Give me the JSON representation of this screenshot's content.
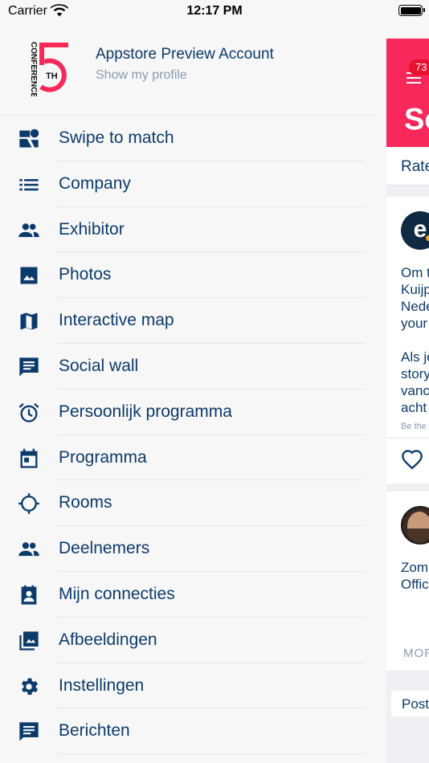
{
  "status_bar": {
    "carrier": "Carrier",
    "time": "12:17 PM"
  },
  "profile": {
    "logo_number": "5",
    "logo_suffix": "TH",
    "logo_text": "CONFERENCE",
    "account_name": "Appstore Preview Account",
    "profile_link": "Show my profile"
  },
  "menu": {
    "items": [
      {
        "label": "Swipe to match",
        "icon": "swipe-match-icon"
      },
      {
        "label": "Company",
        "icon": "list-icon"
      },
      {
        "label": "Exhibitor",
        "icon": "people-icon"
      },
      {
        "label": "Photos",
        "icon": "image-icon"
      },
      {
        "label": "Interactive map",
        "icon": "map-icon"
      },
      {
        "label": "Social wall",
        "icon": "chat-icon"
      },
      {
        "label": "Persoonlijk programma",
        "icon": "alarm-icon"
      },
      {
        "label": "Programma",
        "icon": "calendar-icon"
      },
      {
        "label": "Rooms",
        "icon": "crosshair-icon"
      },
      {
        "label": "Deelnemers",
        "icon": "people-icon"
      },
      {
        "label": "Mijn connecties",
        "icon": "contact-icon"
      },
      {
        "label": "Afbeeldingen",
        "icon": "gallery-icon"
      },
      {
        "label": "Instellingen",
        "icon": "gear-icon"
      },
      {
        "label": "Berichten",
        "icon": "message-icon"
      }
    ]
  },
  "peek": {
    "badge": "73",
    "title": "So",
    "tab": "Rate",
    "card1": {
      "avatar_letter": "e",
      "lines_a": [
        "Om t",
        "Kuijp",
        "Nede",
        "your"
      ],
      "lines_b": [
        "Als je",
        "story",
        "vanc",
        "acht"
      ],
      "small": "Be the"
    },
    "card2": {
      "lines": [
        "Zom",
        "Offic"
      ],
      "more": "MOR"
    },
    "post": "Post"
  },
  "colors": {
    "accent": "#f8285a",
    "text": "#0c3b6b",
    "muted": "#8a9bb0"
  }
}
